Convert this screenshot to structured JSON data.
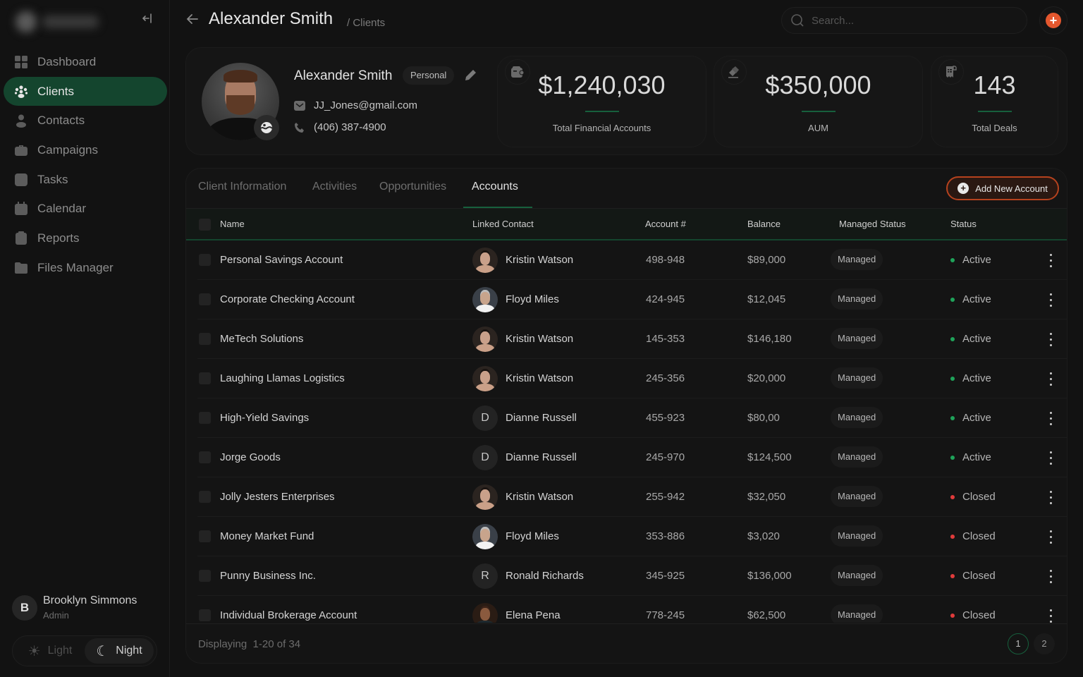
{
  "sidebar": {
    "collapse_icon": "collapse-left-icon",
    "items": [
      {
        "label": "Dashboard",
        "icon": "grid-icon",
        "active": false
      },
      {
        "label": "Clients",
        "icon": "users-icon",
        "active": true
      },
      {
        "label": "Contacts",
        "icon": "person-icon",
        "active": false
      },
      {
        "label": "Campaigns",
        "icon": "briefcase-icon",
        "active": false
      },
      {
        "label": "Tasks",
        "icon": "checklist-icon",
        "active": false
      },
      {
        "label": "Calendar",
        "icon": "calendar-icon",
        "active": false
      },
      {
        "label": "Reports",
        "icon": "clipboard-icon",
        "active": false
      },
      {
        "label": "Files Manager",
        "icon": "folder-icon",
        "active": false
      }
    ],
    "user": {
      "initial": "B",
      "name": "Brooklyn Simmons",
      "role": "Admin"
    },
    "theme": {
      "light_label": "Light",
      "night_label": "Night",
      "selected": "Night"
    }
  },
  "header": {
    "title": "Alexander Smith",
    "breadcrumb": "/ Clients",
    "search_placeholder": "Search..."
  },
  "profile": {
    "name": "Alexander Smith",
    "tag": "Personal",
    "email": "JJ_Jones@gmail.com",
    "phone": "(406) 387-4900"
  },
  "stats": [
    {
      "value": "$1,240,030",
      "label": "Total Financial Accounts",
      "icon": "wallet-icon"
    },
    {
      "value": "$350,000",
      "label": "AUM",
      "icon": "tag-icon"
    },
    {
      "value": "143",
      "label": "Total Deals",
      "icon": "receipt-icon"
    }
  ],
  "tabs": [
    {
      "label": "Client Information",
      "active": false
    },
    {
      "label": "Activities",
      "active": false
    },
    {
      "label": "Opportunities",
      "active": false
    },
    {
      "label": "Accounts",
      "active": true
    }
  ],
  "add_button_label": "Add New Account",
  "table": {
    "columns": [
      "Name",
      "Linked Contact",
      "Account #",
      "Balance",
      "Managed Status",
      "Status"
    ],
    "rows": [
      {
        "name": "Personal Savings Account",
        "contact": "Kristin Watson",
        "avatar": "photo-kw",
        "account": "498-948",
        "balance": "$89,000",
        "managed": "Managed",
        "status": "Active"
      },
      {
        "name": "Corporate Checking Account",
        "contact": "Floyd Miles",
        "avatar": "photo-fm",
        "account": "424-945",
        "balance": "$12,045",
        "managed": "Managed",
        "status": "Active"
      },
      {
        "name": "MeTech Solutions",
        "contact": "Kristin Watson",
        "avatar": "photo-kw",
        "account": "145-353",
        "balance": "$146,180",
        "managed": "Managed",
        "status": "Active"
      },
      {
        "name": "Laughing Llamas Logistics",
        "contact": "Kristin Watson",
        "avatar": "photo-kw",
        "account": "245-356",
        "balance": "$20,000",
        "managed": "Managed",
        "status": "Active"
      },
      {
        "name": "High-Yield Savings",
        "contact": "Dianne Russell",
        "avatar": "D",
        "account": "455-923",
        "balance": "$80,00",
        "managed": "Managed",
        "status": "Active"
      },
      {
        "name": "Jorge Goods",
        "contact": "Dianne Russell",
        "avatar": "D",
        "account": "245-970",
        "balance": "$124,500",
        "managed": "Managed",
        "status": "Active"
      },
      {
        "name": "Jolly Jesters Enterprises",
        "contact": "Kristin Watson",
        "avatar": "photo-kw",
        "account": "255-942",
        "balance": "$32,050",
        "managed": "Managed",
        "status": "Closed"
      },
      {
        "name": "Money Market Fund",
        "contact": "Floyd Miles",
        "avatar": "photo-fm",
        "account": "353-886",
        "balance": "$3,020",
        "managed": "Managed",
        "status": "Closed"
      },
      {
        "name": "Punny Business Inc.",
        "contact": "Ronald Richards",
        "avatar": "R",
        "account": "345-925",
        "balance": "$136,000",
        "managed": "Managed",
        "status": "Closed"
      },
      {
        "name": "Individual Brokerage Account",
        "contact": "Elena Pena",
        "avatar": "photo-ep",
        "account": "778-245",
        "balance": "$62,500",
        "managed": "Managed",
        "status": "Closed"
      }
    ]
  },
  "footer": {
    "displaying_label": "Displaying",
    "range": "1-20 of 34",
    "pages": [
      "1",
      "2"
    ],
    "current_page": "1"
  },
  "colors": {
    "accent_green": "#14452e",
    "accent_orange": "#e4572e",
    "status_active": "#1fa35a",
    "status_closed": "#e03b3b"
  }
}
